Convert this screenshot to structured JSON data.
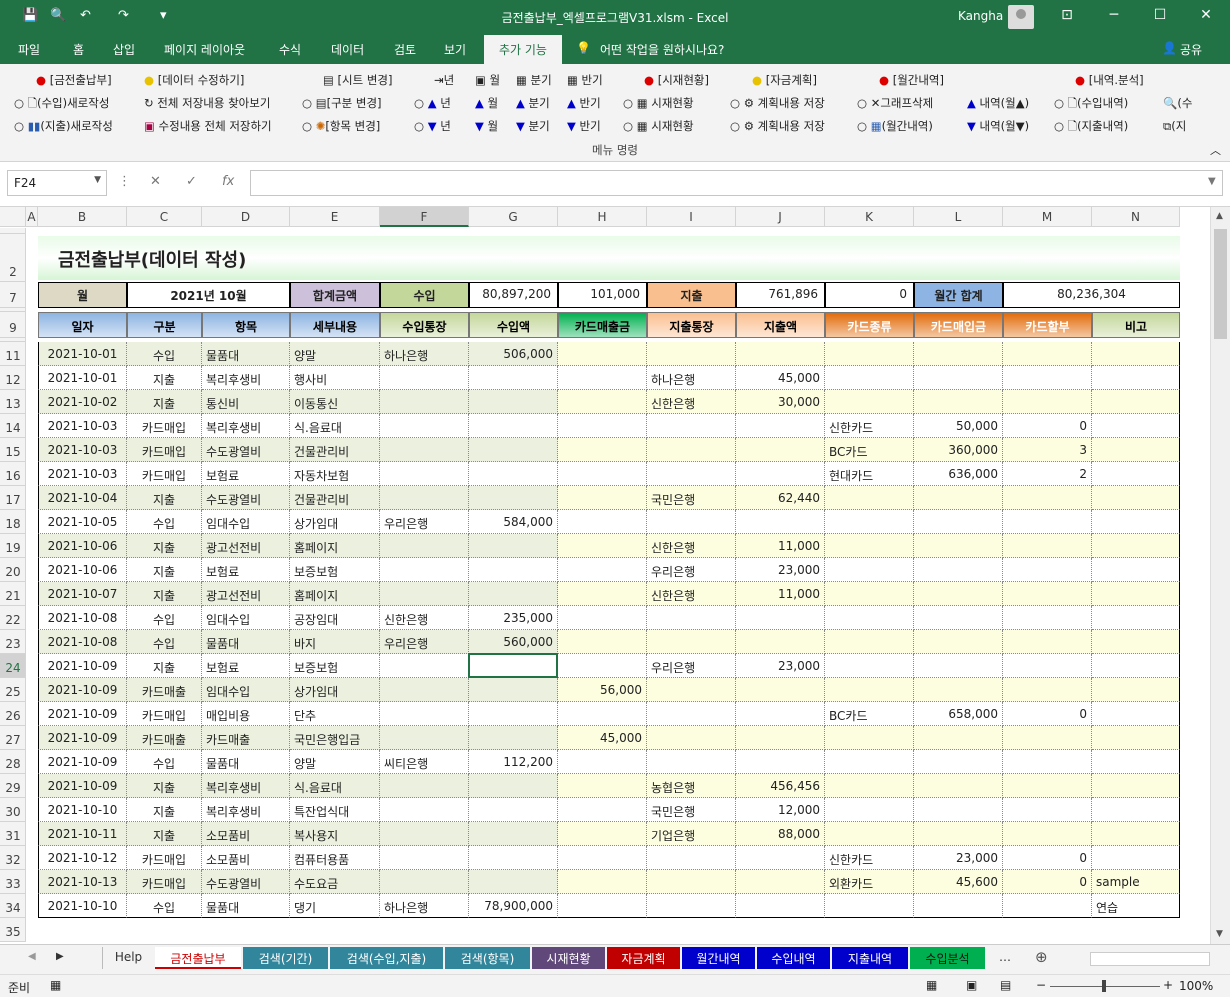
{
  "window": {
    "title": "금전출납부_엑셀프로그램V31.xlsm  -  Excel",
    "user": "Kangha"
  },
  "menu": {
    "items": [
      "파일",
      "홈",
      "삽입",
      "페이지 레이아웃",
      "수식",
      "데이터",
      "검토",
      "보기"
    ],
    "active": "추가 기능",
    "tell": "어떤 작업을 원하시나요?",
    "share": "공유"
  },
  "ribbon": {
    "row1": [
      "[금전출납부]",
      "[데이터 수정하기]",
      "[시트 변경]",
      "년",
      "월",
      "분기",
      "반기",
      "[시재현황]",
      "[자금계획]",
      "[월간내역]",
      "[내역.분석]"
    ],
    "row2": [
      "(수입)새로작성",
      "전체 저장내용 찾아보기",
      "[구분 변경]",
      "년",
      "월",
      "분기",
      "반기",
      "시재현황",
      "계획내용 저장",
      "그래프삭제",
      "내역(월▲)",
      "(수입내역)",
      "(수"
    ],
    "row3": [
      "(지출)새로작성",
      "수정내용 전체 저장하기",
      "[항목 변경]",
      "년",
      "월",
      "분기",
      "반기",
      "시재현황",
      "계획내용 저장",
      "(월간내역)",
      "내역(월▼)",
      "(지출내역)",
      "(지"
    ],
    "caption": "메뉴 명령"
  },
  "formula": {
    "namebox": "F24",
    "fx": "fx",
    "value": ""
  },
  "columns": [
    "A",
    "B",
    "C",
    "D",
    "E",
    "F",
    "G",
    "H",
    "I",
    "J",
    "K",
    "L",
    "M",
    "N"
  ],
  "sheet": {
    "title": "금전출납부(데이터 작성)",
    "summary": {
      "month_label": "월",
      "month_value": "2021년 10월",
      "total_label": "합계금액",
      "income_label": "수입",
      "income_value": "80,897,200",
      "card_sales_value": "101,000",
      "expense_label": "지출",
      "expense_value": "761,896",
      "card_buy_value": "0",
      "monthly_label": "월간 합계",
      "monthly_value": "80,236,304"
    },
    "headers": [
      "일자",
      "구분",
      "항목",
      "세부내용",
      "수입통장",
      "수입액",
      "카드매출금",
      "지출통장",
      "지출액",
      "카드종류",
      "카드매입금",
      "카드할부",
      "비고"
    ],
    "rows": [
      {
        "r": "11",
        "c": [
          "2021-10-01",
          "수입",
          "물품대",
          "양말",
          "하나은행",
          "506,000",
          "",
          "",
          "",
          "",
          "",
          "",
          ""
        ]
      },
      {
        "r": "12",
        "c": [
          "2021-10-01",
          "지출",
          "복리후생비",
          "행사비",
          "",
          "",
          "",
          "하나은행",
          "45,000",
          "",
          "",
          "",
          ""
        ]
      },
      {
        "r": "13",
        "c": [
          "2021-10-02",
          "지출",
          "통신비",
          "이동통신",
          "",
          "",
          "",
          "신한은행",
          "30,000",
          "",
          "",
          "",
          ""
        ]
      },
      {
        "r": "14",
        "c": [
          "2021-10-03",
          "카드매입",
          "복리후생비",
          "식.음료대",
          "",
          "",
          "",
          "",
          "",
          "신한카드",
          "50,000",
          "0",
          ""
        ]
      },
      {
        "r": "15",
        "c": [
          "2021-10-03",
          "카드매입",
          "수도광열비",
          "건물관리비",
          "",
          "",
          "",
          "",
          "",
          "BC카드",
          "360,000",
          "3",
          ""
        ]
      },
      {
        "r": "16",
        "c": [
          "2021-10-03",
          "카드매입",
          "보험료",
          "자동차보험",
          "",
          "",
          "",
          "",
          "",
          "현대카드",
          "636,000",
          "2",
          ""
        ]
      },
      {
        "r": "17",
        "c": [
          "2021-10-04",
          "지출",
          "수도광열비",
          "건물관리비",
          "",
          "",
          "",
          "국민은행",
          "62,440",
          "",
          "",
          "",
          ""
        ]
      },
      {
        "r": "18",
        "c": [
          "2021-10-05",
          "수입",
          "임대수입",
          "상가임대",
          "우리은행",
          "584,000",
          "",
          "",
          "",
          "",
          "",
          "",
          ""
        ]
      },
      {
        "r": "19",
        "c": [
          "2021-10-06",
          "지출",
          "광고선전비",
          "홈페이지",
          "",
          "",
          "",
          "신한은행",
          "11,000",
          "",
          "",
          "",
          ""
        ]
      },
      {
        "r": "20",
        "c": [
          "2021-10-06",
          "지출",
          "보험료",
          "보증보험",
          "",
          "",
          "",
          "우리은행",
          "23,000",
          "",
          "",
          "",
          ""
        ]
      },
      {
        "r": "21",
        "c": [
          "2021-10-07",
          "지출",
          "광고선전비",
          "홈페이지",
          "",
          "",
          "",
          "신한은행",
          "11,000",
          "",
          "",
          "",
          ""
        ]
      },
      {
        "r": "22",
        "c": [
          "2021-10-08",
          "수입",
          "임대수입",
          "공장임대",
          "신한은행",
          "235,000",
          "",
          "",
          "",
          "",
          "",
          "",
          ""
        ]
      },
      {
        "r": "23",
        "c": [
          "2021-10-08",
          "수입",
          "물품대",
          "바지",
          "우리은행",
          "560,000",
          "",
          "",
          "",
          "",
          "",
          "",
          ""
        ]
      },
      {
        "r": "24",
        "c": [
          "2021-10-09",
          "지출",
          "보험료",
          "보증보험",
          "",
          "",
          "",
          "우리은행",
          "23,000",
          "",
          "",
          "",
          ""
        ]
      },
      {
        "r": "25",
        "c": [
          "2021-10-09",
          "카드매출",
          "임대수입",
          "상가임대",
          "",
          "",
          "56,000",
          "",
          "",
          "",
          "",
          "",
          ""
        ]
      },
      {
        "r": "26",
        "c": [
          "2021-10-09",
          "카드매입",
          "매입비용",
          "단추",
          "",
          "",
          "",
          "",
          "",
          "BC카드",
          "658,000",
          "0",
          ""
        ]
      },
      {
        "r": "27",
        "c": [
          "2021-10-09",
          "카드매출",
          "카드매출",
          "국민은행입금",
          "",
          "",
          "45,000",
          "",
          "",
          "",
          "",
          "",
          ""
        ]
      },
      {
        "r": "28",
        "c": [
          "2021-10-09",
          "수입",
          "물품대",
          "양말",
          "씨티은행",
          "112,200",
          "",
          "",
          "",
          "",
          "",
          "",
          ""
        ]
      },
      {
        "r": "29",
        "c": [
          "2021-10-09",
          "지출",
          "복리후생비",
          "식.음료대",
          "",
          "",
          "",
          "농협은행",
          "456,456",
          "",
          "",
          "",
          ""
        ]
      },
      {
        "r": "30",
        "c": [
          "2021-10-10",
          "지출",
          "복리후생비",
          "특잔업식대",
          "",
          "",
          "",
          "국민은행",
          "12,000",
          "",
          "",
          "",
          ""
        ]
      },
      {
        "r": "31",
        "c": [
          "2021-10-11",
          "지출",
          "소모품비",
          "복사용지",
          "",
          "",
          "",
          "기업은행",
          "88,000",
          "",
          "",
          "",
          ""
        ]
      },
      {
        "r": "32",
        "c": [
          "2021-10-12",
          "카드매입",
          "소모품비",
          "컴퓨터용품",
          "",
          "",
          "",
          "",
          "",
          "신한카드",
          "23,000",
          "0",
          ""
        ]
      },
      {
        "r": "33",
        "c": [
          "2021-10-13",
          "카드매입",
          "수도광열비",
          "수도요금",
          "",
          "",
          "",
          "",
          "",
          "외환카드",
          "45,600",
          "0",
          "sample"
        ]
      },
      {
        "r": "34",
        "c": [
          "2021-10-10",
          "수입",
          "물품대",
          "댕기",
          "하나은행",
          "78,900,000",
          "",
          "",
          "",
          "",
          "",
          "",
          "연습"
        ]
      }
    ]
  },
  "tabs": [
    "Help",
    "금전출납부",
    "검색(기간)",
    "검색(수입,지출)",
    "검색(항목)",
    "시재현황",
    "자금계획",
    "월간내역",
    "수입내역",
    "지출내역",
    "수입분석",
    "…"
  ],
  "status": {
    "ready": "준비",
    "zoom": "100%"
  }
}
